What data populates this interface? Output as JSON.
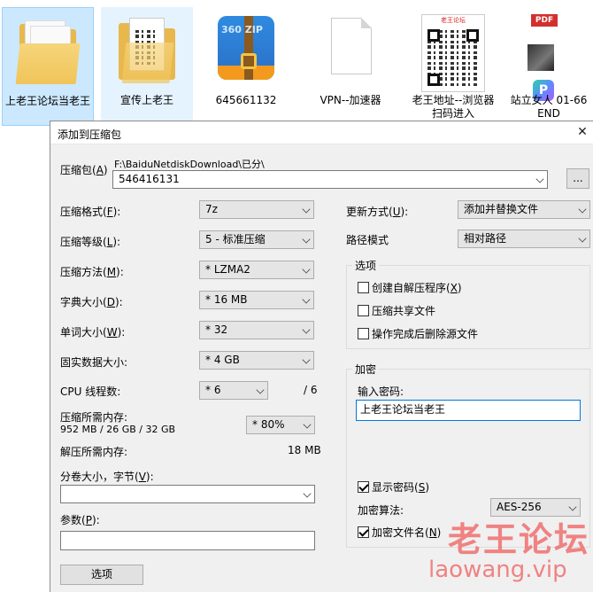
{
  "desktop": {
    "files": [
      {
        "name": "上老王论坛当老王",
        "type": "folder"
      },
      {
        "name": "宣传上老王",
        "type": "folder-qr"
      },
      {
        "name": "645661132",
        "type": "zip",
        "icon_text": "360 ZIP"
      },
      {
        "name": "VPN--加速器",
        "type": "document"
      },
      {
        "name": "老王地址--浏览器扫码进入",
        "type": "qr-image",
        "badge": "老王论坛"
      },
      {
        "name": "站立女人 01-66 END",
        "type": "pdf",
        "badge": "PDF"
      }
    ]
  },
  "dialog": {
    "title": "添加到压缩包",
    "archive_label": "压缩包(",
    "archive_hotkey": "A",
    "archive_label_end": ")",
    "archive_path": "F:\\BaiduNetdiskDownload\\已分\\",
    "archive_name": "546416131",
    "browse_label": "...",
    "left_fields": [
      {
        "label": "压缩格式(",
        "hotkey": "F",
        "end": "):",
        "value": "7z"
      },
      {
        "label": "压缩等级(",
        "hotkey": "L",
        "end": "):",
        "value": "5 - 标准压缩"
      },
      {
        "label": "压缩方法(",
        "hotkey": "M",
        "end": "):",
        "value": "*  LZMA2"
      },
      {
        "label": "字典大小(",
        "hotkey": "D",
        "end": "):",
        "value": "*  16 MB"
      },
      {
        "label": "单词大小(",
        "hotkey": "W",
        "end": "):",
        "value": "*  32"
      },
      {
        "label": "固实数据大小:",
        "hotkey": "",
        "end": "",
        "value": "*  4 GB"
      }
    ],
    "cpu_label": "CPU 线程数:",
    "cpu_value": "*  6",
    "cpu_max": "/ 6",
    "mem_compress_label": "压缩所需内存:",
    "mem_compress_detail": "952 MB / 26 GB / 32 GB",
    "mem_percent": "*  80%",
    "mem_decompress_label": "解压所需内存:",
    "mem_decompress_value": "18 MB",
    "split_label": "分卷大小，字节(",
    "split_hotkey": "V",
    "split_end": "):",
    "split_value": "",
    "params_label": "参数(",
    "params_hotkey": "P",
    "params_end": "):",
    "params_value": "",
    "options_button": "选项",
    "update_label": "更新方式(",
    "update_hotkey": "U",
    "update_end": "):",
    "update_value": "添加并替换文件",
    "path_label": "路径模式",
    "path_value": "相对路径",
    "options_group": "选项",
    "opt_sfx": "创建自解压程序(",
    "opt_sfx_hotkey": "X",
    "opt_sfx_end": ")",
    "opt_shared": "压缩共享文件",
    "opt_delete": "操作完成后删除源文件",
    "encrypt_group": "加密",
    "password_label": "输入密码:",
    "password_value": "上老王论坛当老王",
    "show_password": "显示密码(",
    "show_password_hotkey": "S",
    "show_password_end": ")",
    "encrypt_algo_label": "加密算法:",
    "encrypt_algo_value": "AES-256",
    "encrypt_names": "加密文件名(",
    "encrypt_names_hotkey": "N",
    "encrypt_names_end": ")",
    "checked": {
      "sfx": false,
      "shared": false,
      "delete": false,
      "show_password": true,
      "encrypt_names": true
    }
  },
  "watermark": {
    "cn": "老王论坛",
    "en": "laowang.vip"
  }
}
